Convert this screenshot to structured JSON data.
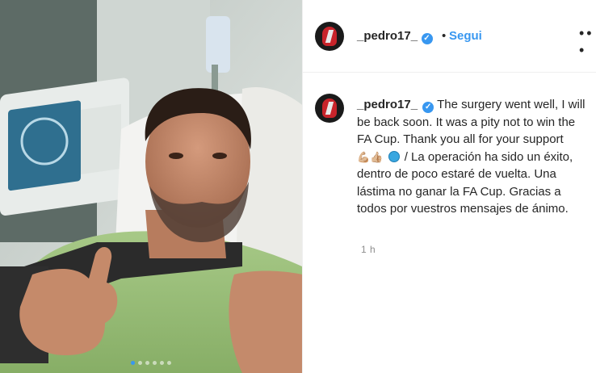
{
  "header": {
    "username": "_pedro17_",
    "separator": "•",
    "follow_label": "Segui",
    "more_label": "• • •"
  },
  "caption": {
    "username": "_pedro17_",
    "text_en": "The surgery went well, I will be back soon. It was a pity not to win the FA Cup. Thank you all for your support",
    "emoji": "💪🏼👍🏼",
    "text_es": "/ La operación ha sido un éxito, dentro de poco estaré de vuelta. Una lástima no ganar la FA Cup. Gracias a todos por vuestros mensajes de ánimo.",
    "timestamp": "1 h"
  },
  "carousel": {
    "count": 6,
    "active_index": 0
  },
  "colors": {
    "accent": "#3897f0",
    "text": "#262626",
    "muted": "#8e8e8e",
    "shirt": "#9bc07a"
  }
}
